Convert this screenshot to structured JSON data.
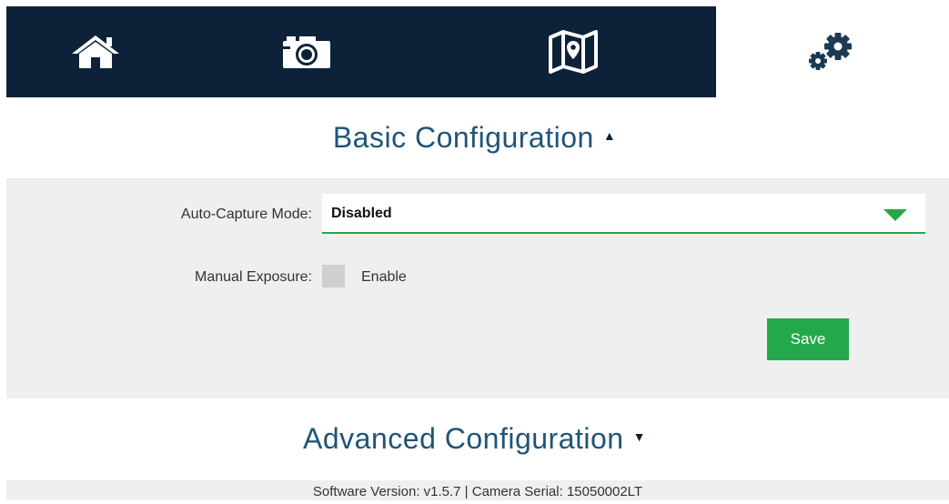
{
  "nav": {
    "tabs": [
      {
        "icon": "home-icon",
        "active": false
      },
      {
        "icon": "camera-icon",
        "active": false
      },
      {
        "icon": "map-icon",
        "active": false
      },
      {
        "icon": "settings-gears-icon",
        "active": true
      }
    ]
  },
  "basic": {
    "title": "Basic Configuration",
    "expanded": true,
    "auto_capture_label": "Auto-Capture Mode:",
    "auto_capture_value": "Disabled",
    "manual_exposure_label": "Manual Exposure:",
    "manual_exposure_checkbox_label": "Enable",
    "manual_exposure_checked": false,
    "save_label": "Save"
  },
  "advanced": {
    "title": "Advanced Configuration",
    "expanded": false
  },
  "footer": {
    "text": "Software Version: v1.5.7 | Camera Serial: 15050002LT"
  },
  "colors": {
    "navbar": "#0d2238",
    "accent_green": "#23a94b",
    "header_blue": "#1f5577",
    "panel_gray": "#efefef"
  }
}
